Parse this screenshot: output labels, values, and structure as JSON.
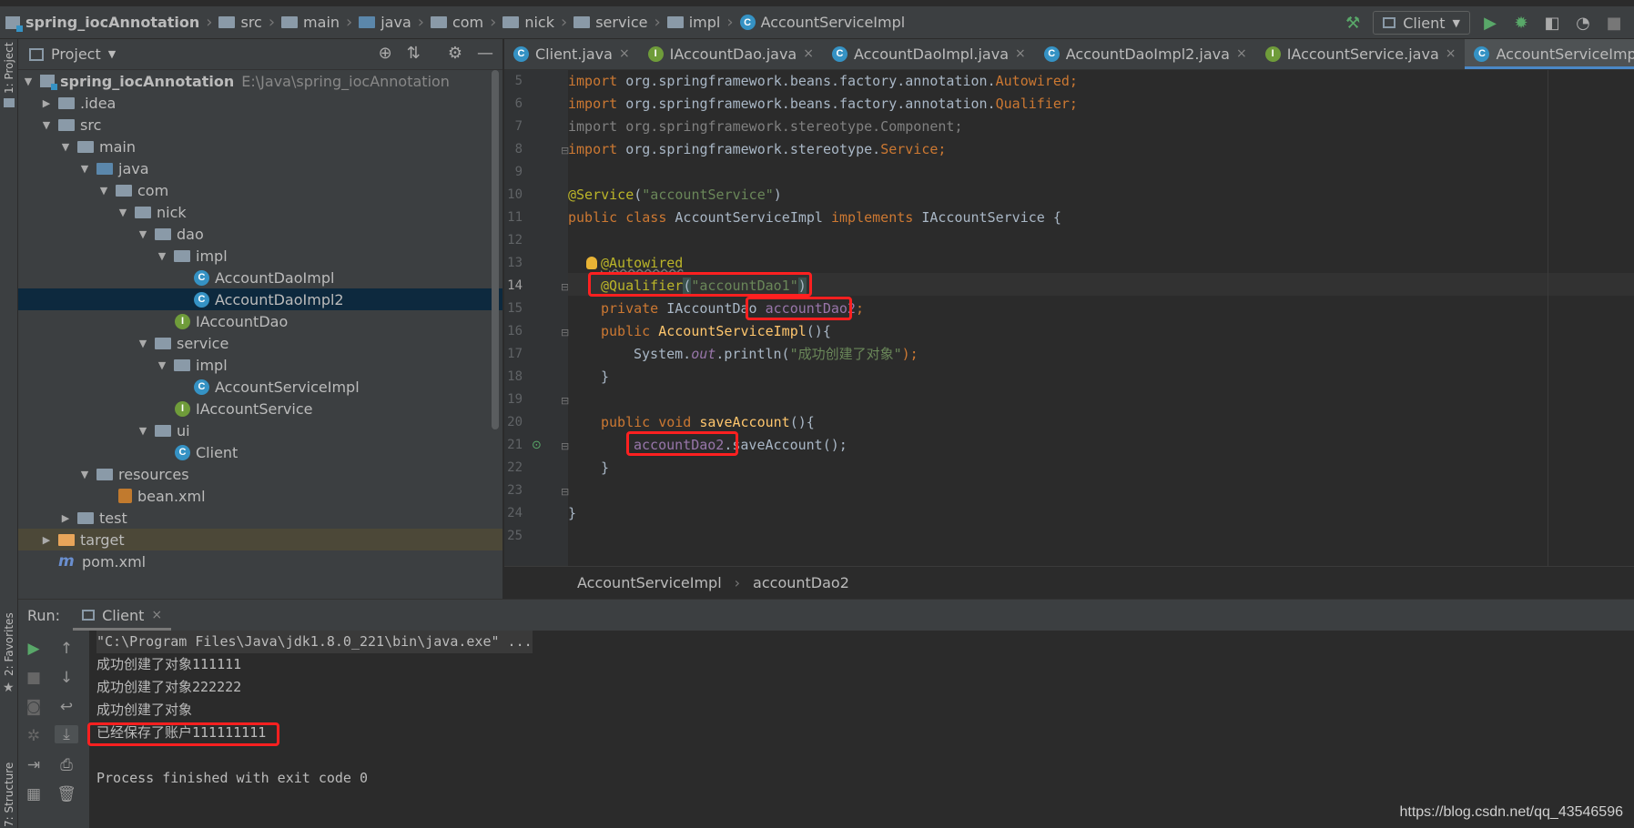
{
  "breadcrumb": [
    "spring_iocAnnotation",
    "src",
    "main",
    "java",
    "com",
    "nick",
    "service",
    "impl",
    "AccountServiceImpl"
  ],
  "toolbar": {
    "run_config": "Client"
  },
  "sidebar": {
    "project_tab": "1: Project",
    "favorites_tab": "2: Favorites",
    "structure_tab": "7: Structure"
  },
  "project": {
    "title": "Project",
    "tree": [
      {
        "label": "spring_iocAnnotation",
        "path": "E:\\Java\\spring_iocAnnotation"
      },
      {
        "label": ".idea"
      },
      {
        "label": "src"
      },
      {
        "label": "main"
      },
      {
        "label": "java"
      },
      {
        "label": "com"
      },
      {
        "label": "nick"
      },
      {
        "label": "dao"
      },
      {
        "label": "impl"
      },
      {
        "label": "AccountDaoImpl"
      },
      {
        "label": "AccountDaoImpl2"
      },
      {
        "label": "IAccountDao"
      },
      {
        "label": "service"
      },
      {
        "label": "impl"
      },
      {
        "label": "AccountServiceImpl"
      },
      {
        "label": "IAccountService"
      },
      {
        "label": "ui"
      },
      {
        "label": "Client"
      },
      {
        "label": "resources"
      },
      {
        "label": "bean.xml"
      },
      {
        "label": "test"
      },
      {
        "label": "target"
      },
      {
        "label": "pom.xml"
      }
    ]
  },
  "tabs": [
    "Client.java",
    "IAccountDao.java",
    "AccountDaoImpl.java",
    "AccountDaoImpl2.java",
    "IAccountService.java",
    "AccountServiceImpl.java"
  ],
  "editor": {
    "line_numbers": [
      "5",
      "6",
      "7",
      "8",
      "9",
      "10",
      "11",
      "12",
      "13",
      "14",
      "15",
      "16",
      "17",
      "18",
      "19",
      "20",
      "21",
      "22",
      "23",
      "24",
      "25"
    ],
    "code": {
      "l5_kw": "import ",
      "l5_pkg": "org.springframework.beans.factory.annotation.",
      "l5_cls": "Autowired",
      "l5_end": ";",
      "l6_kw": "import ",
      "l6_pkg": "org.springframework.beans.factory.annotation.",
      "l6_cls": "Qualifier",
      "l6_end": ";",
      "l7": "import org.springframework.stereotype.Component;",
      "l8_kw": "import ",
      "l8_pkg": "org.springframework.stereotype.",
      "l8_cls": "Service",
      "l8_end": ";",
      "l10_ann": "@Service",
      "l10_p1": "(",
      "l10_str": "\"accountService\"",
      "l10_p2": ")",
      "l11_kw1": "public class ",
      "l11_name": "AccountServiceImpl ",
      "l11_kw2": "implements ",
      "l11_rest": "IAccountService {",
      "l13": "@Autowired",
      "l14_ann": "@Qualifier",
      "l14_p1": "(",
      "l14_str": "\"accountDao1\"",
      "l14_p2": ")",
      "l15_kw": "private ",
      "l15_type": "IAccountDao ",
      "l15_field": "accountDao2",
      "l15_end": ";",
      "l16_kw": "public ",
      "l16_m": "AccountServiceImpl",
      "l16_rest": "(){",
      "l17_a": "System.",
      "l17_out": "out",
      "l17_b": ".println(",
      "l17_str": "\"成功创建了对象\"",
      "l17_c": ");",
      "l18": "}",
      "l20_kw": "public void ",
      "l20_m": "saveAccount",
      "l20_rest": "(){",
      "l21_field": "accountDao2",
      "l21_rest": ".saveAccount();",
      "l22": "}",
      "l24": "}"
    },
    "crumb": [
      "AccountServiceImpl",
      "accountDao2"
    ]
  },
  "run": {
    "label": "Run:",
    "tab": "Client",
    "output": [
      "\"C:\\Program Files\\Java\\jdk1.8.0_221\\bin\\java.exe\" ...",
      "成功创建了对象111111",
      "成功创建了对象222222",
      "成功创建了对象",
      "已经保存了账户111111111",
      "Process finished with exit code 0"
    ]
  },
  "watermark": "https://blog.csdn.net/qq_43546596"
}
